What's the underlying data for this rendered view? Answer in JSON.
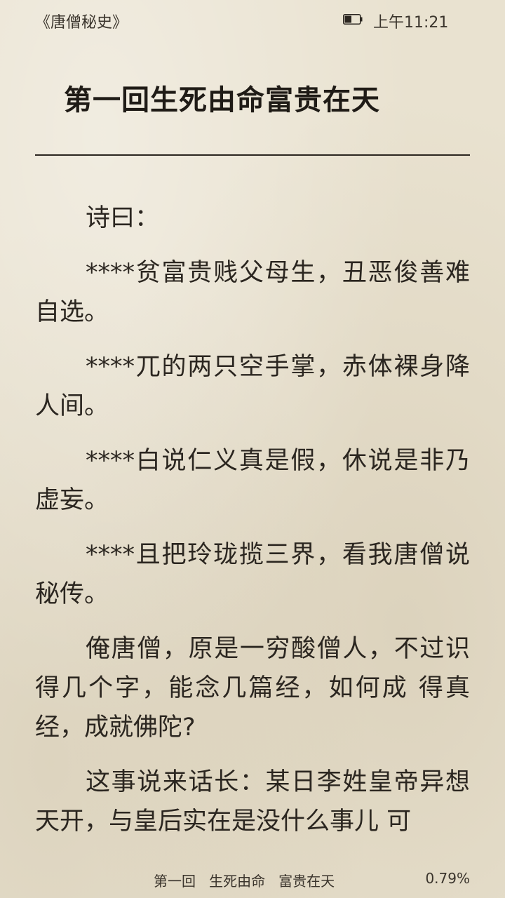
{
  "status_bar": {
    "book_title": "《唐僧秘史》",
    "battery_icon": "battery-icon",
    "battery_level": 0.45,
    "time": "上午11:21"
  },
  "chapter": {
    "title": "第一回生死由命富贵在天"
  },
  "paragraphs": [
    "诗曰：",
    "****贫富贵贱父母生，丑恶俊善难自选。",
    "****兀的两只空手掌，赤体裸身降人间。",
    "****白说仁义真是假，休说是非乃虚妄。",
    "****且把玲珑揽三界，看我唐僧说秘传。",
    "俺唐僧，原是一穷酸僧人，不过识得几个字，能念几篇经，如何成 得真经，成就佛陀?",
    "这事说来话长：某日李姓皇帝异想天开，与皇后实在是没什么事儿 可"
  ],
  "footer": {
    "chapter_label": "第一回   生死由命   富贵在天",
    "progress": "0.79%"
  }
}
